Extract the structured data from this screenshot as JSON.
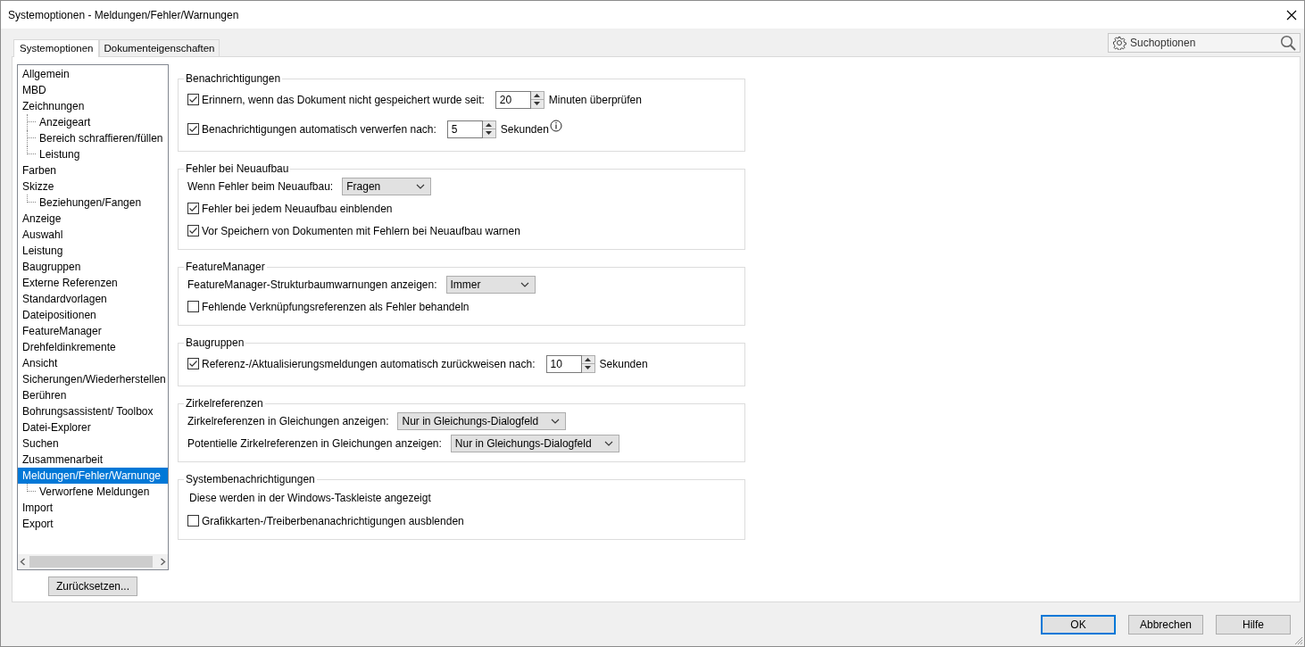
{
  "window": {
    "title": "Systemoptionen - Meldungen/Fehler/Warnungen"
  },
  "tabs": [
    {
      "label": "Systemoptionen",
      "selected": true
    },
    {
      "label": "Dokumenteigenschaften",
      "selected": false
    }
  ],
  "search": {
    "placeholder": "Suchoptionen"
  },
  "tree": {
    "items": [
      {
        "label": "Allgemein",
        "selected": false
      },
      {
        "label": "MBD",
        "selected": false
      },
      {
        "label": "Zeichnungen",
        "selected": false,
        "children": [
          {
            "label": "Anzeigeart",
            "selected": false
          },
          {
            "label": "Bereich schraffieren/füllen",
            "selected": false
          },
          {
            "label": "Leistung",
            "selected": false
          }
        ]
      },
      {
        "label": "Farben",
        "selected": false
      },
      {
        "label": "Skizze",
        "selected": false,
        "children": [
          {
            "label": "Beziehungen/Fangen",
            "selected": false
          }
        ]
      },
      {
        "label": "Anzeige",
        "selected": false
      },
      {
        "label": "Auswahl",
        "selected": false
      },
      {
        "label": "Leistung",
        "selected": false
      },
      {
        "label": "Baugruppen",
        "selected": false
      },
      {
        "label": "Externe Referenzen",
        "selected": false
      },
      {
        "label": "Standardvorlagen",
        "selected": false
      },
      {
        "label": "Dateipositionen",
        "selected": false
      },
      {
        "label": "FeatureManager",
        "selected": false
      },
      {
        "label": "Drehfeldinkremente",
        "selected": false
      },
      {
        "label": "Ansicht",
        "selected": false
      },
      {
        "label": "Sicherungen/Wiederherstellen",
        "selected": false
      },
      {
        "label": "Berühren",
        "selected": false
      },
      {
        "label": "Bohrungsassistent/ Toolbox",
        "selected": false
      },
      {
        "label": "Datei-Explorer",
        "selected": false
      },
      {
        "label": "Suchen",
        "selected": false
      },
      {
        "label": "Zusammenarbeit",
        "selected": false
      },
      {
        "label": "Meldungen/Fehler/Warnunge",
        "selected": true,
        "children": [
          {
            "label": "Verworfene Meldungen",
            "selected": false
          }
        ]
      },
      {
        "label": "Import",
        "selected": false
      },
      {
        "label": "Export",
        "selected": false
      }
    ]
  },
  "reset_button": "Zurücksetzen...",
  "groups": [
    {
      "title": "Benachrichtigungen",
      "rows": [
        {
          "kind": "check",
          "label": "Erinnern, wenn das Dokument nicht gespeichert wurde seit:",
          "checked": true,
          "spinner": {
            "value": "20"
          },
          "suffix": "Minuten überprüfen",
          "info": false
        },
        {
          "kind": "check",
          "label": "Benachrichtigungen automatisch verwerfen nach:",
          "checked": true,
          "spinner": {
            "value": "5"
          },
          "suffix": "Sekunden",
          "info": true
        }
      ]
    },
    {
      "title": "Fehler bei Neuaufbau",
      "rows": [
        {
          "kind": "select",
          "label": "Wenn Fehler beim Neuaufbau:",
          "value": "Fragen"
        },
        {
          "kind": "check",
          "label": "Fehler bei jedem Neuaufbau einblenden",
          "checked": true
        },
        {
          "kind": "check",
          "label": "Vor Speichern von Dokumenten mit Fehlern bei Neuaufbau warnen",
          "checked": true
        }
      ]
    },
    {
      "title": "FeatureManager",
      "rows": [
        {
          "kind": "select",
          "label": "FeatureManager-Strukturbaumwarnungen anzeigen:",
          "value": "Immer"
        },
        {
          "kind": "check",
          "label": "Fehlende Verknüpfungsreferenzen als Fehler behandeln",
          "checked": false
        }
      ]
    },
    {
      "title": "Baugruppen",
      "rows": [
        {
          "kind": "check",
          "label": "Referenz-/Aktualisierungsmeldungen automatisch zurückweisen nach:",
          "checked": true,
          "spinner": {
            "value": "10"
          },
          "suffix": "Sekunden",
          "info": false
        }
      ]
    },
    {
      "title": "Zirkelreferenzen",
      "rows": [
        {
          "kind": "select",
          "label": "Zirkelreferenzen in Gleichungen anzeigen:",
          "value": "Nur in Gleichungs-Dialogfeld"
        },
        {
          "kind": "select",
          "label": "Potentielle Zirkelreferenzen in Gleichungen anzeigen:",
          "value": "Nur in Gleichungs-Dialogfeld"
        }
      ]
    },
    {
      "title": "Systembenachrichtigungen",
      "rows": [
        {
          "kind": "note",
          "text": "Diese werden in der Windows-Taskleiste angezeigt"
        },
        {
          "kind": "check",
          "label": "Grafikkarten-/Treiberbenanachrichtigungen ausblenden",
          "checked": false
        }
      ]
    }
  ],
  "buttons": [
    {
      "label": "OK",
      "default": true
    },
    {
      "label": "Abbrechen",
      "default": false
    },
    {
      "label": "Hilfe",
      "default": false
    }
  ]
}
